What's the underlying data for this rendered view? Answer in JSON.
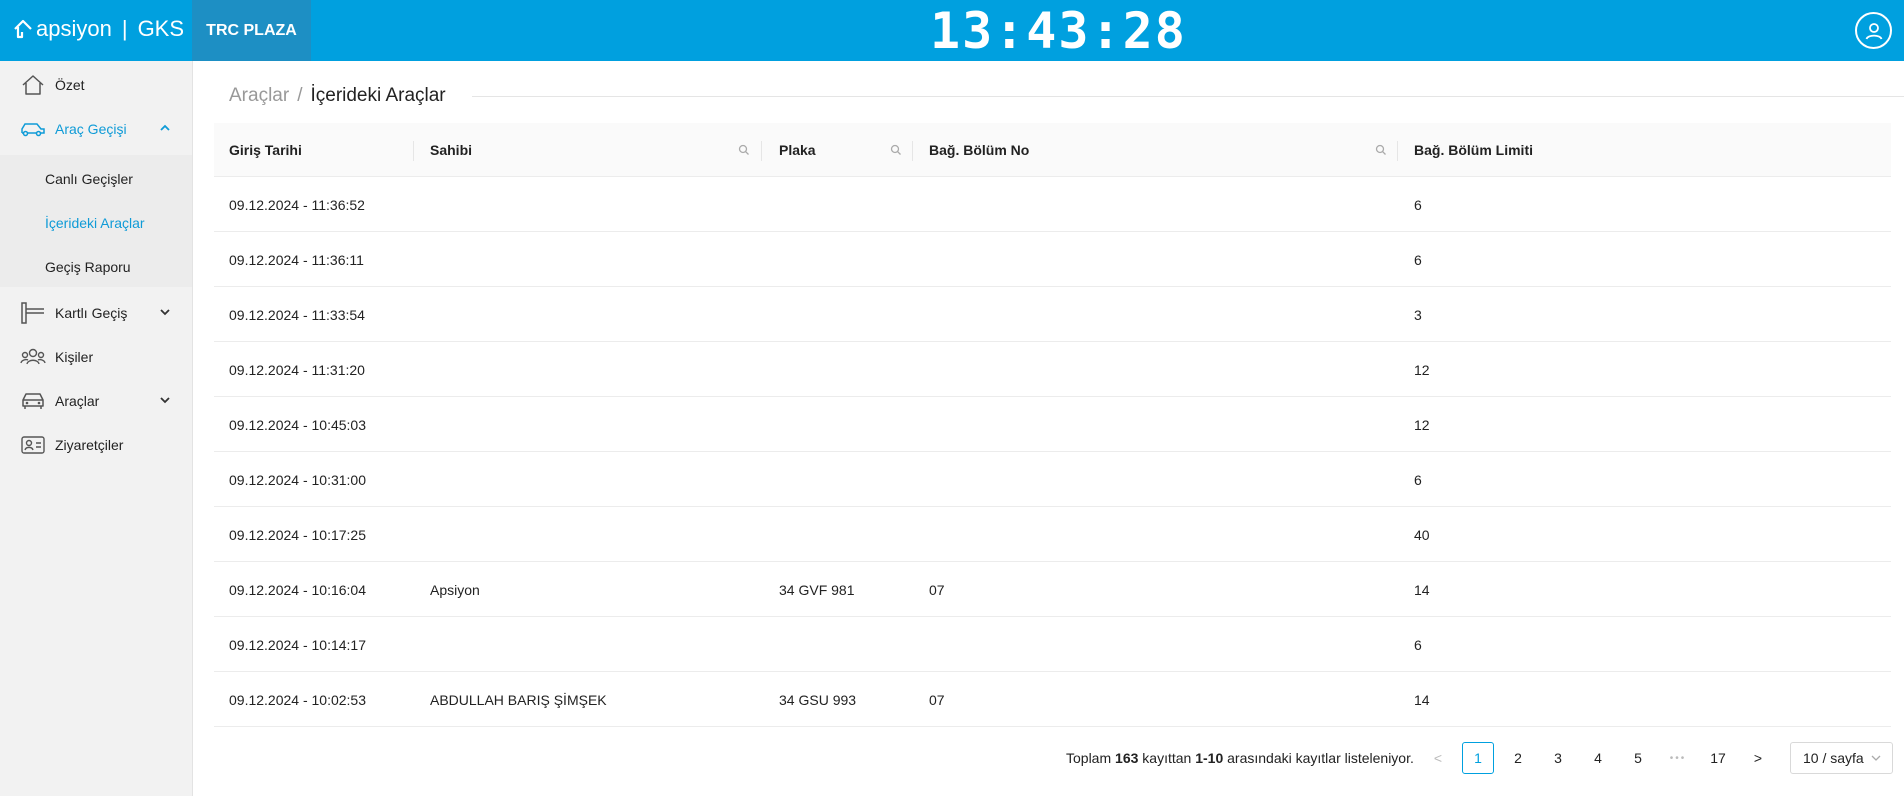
{
  "header": {
    "brand": "apsiyon",
    "product": "GKS",
    "site": "TRC PLAZA",
    "clock": "13:43:28"
  },
  "sidebar": {
    "items": [
      {
        "label": "Özet",
        "icon": "home-icon"
      },
      {
        "label": "Araç Geçişi",
        "icon": "car-icon",
        "expanded": true
      },
      {
        "label": "Kartlı Geçiş",
        "icon": "barrier-icon"
      },
      {
        "label": "Kişiler",
        "icon": "people-icon"
      },
      {
        "label": "Araçlar",
        "icon": "car-front-icon"
      },
      {
        "label": "Ziyaretçiler",
        "icon": "visitor-card-icon"
      }
    ],
    "submenu": [
      {
        "label": "Canlı Geçişler"
      },
      {
        "label": "İçerideki Araçlar",
        "active": true
      },
      {
        "label": "Geçiş Raporu"
      }
    ]
  },
  "breadcrumb": {
    "parent": "Araçlar",
    "separator": "/",
    "current": "İçerideki Araçlar"
  },
  "table": {
    "columns": [
      "Giriş Tarihi",
      "Sahibi",
      "Plaka",
      "Bağ. Bölüm No",
      "Bağ. Bölüm Limiti"
    ],
    "rows": [
      [
        "09.12.2024 - 11:36:52",
        "",
        "",
        "",
        "6"
      ],
      [
        "09.12.2024 - 11:36:11",
        "",
        "",
        "",
        "6"
      ],
      [
        "09.12.2024 - 11:33:54",
        "",
        "",
        "",
        "3"
      ],
      [
        "09.12.2024 - 11:31:20",
        "",
        "",
        "",
        "12"
      ],
      [
        "09.12.2024 - 10:45:03",
        "",
        "",
        "",
        "12"
      ],
      [
        "09.12.2024 - 10:31:00",
        "",
        "",
        "",
        "6"
      ],
      [
        "09.12.2024 - 10:17:25",
        "",
        "",
        "",
        "40"
      ],
      [
        "09.12.2024 - 10:16:04",
        "Apsiyon",
        "34 GVF 981",
        "07",
        "14"
      ],
      [
        "09.12.2024 - 10:14:17",
        "",
        "",
        "",
        "6"
      ],
      [
        "09.12.2024 - 10:02:53",
        "ABDULLAH BARIŞ ŞİMŞEK",
        "34 GSU 993",
        "07",
        "14"
      ]
    ]
  },
  "pagination": {
    "total_prefix": "Toplam",
    "total": "163",
    "total_mid": "kayıttan",
    "range": "1-10",
    "total_suffix": "arasındaki kayıtlar listeleniyor.",
    "prev": "<",
    "next": ">",
    "pages": [
      "1",
      "2",
      "3",
      "4",
      "5"
    ],
    "ellipsis": "•••",
    "last": "17",
    "current": 1,
    "page_size": "10 / sayfa"
  },
  "colors": {
    "header": "#00a0df",
    "site_tab": "#1d8fc4",
    "accent": "#0f9bd7"
  }
}
